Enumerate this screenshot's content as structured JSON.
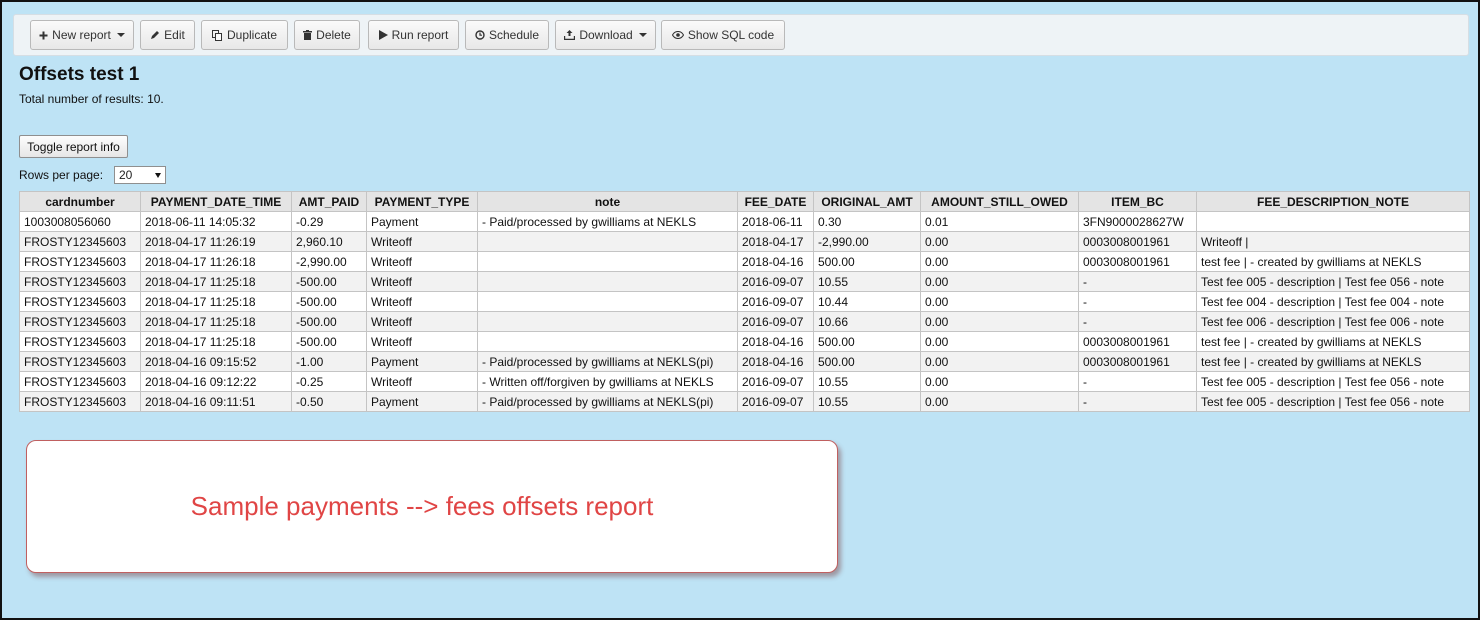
{
  "toolbar": {
    "new_report": "New report",
    "edit": "Edit",
    "duplicate": "Duplicate",
    "delete": "Delete",
    "run_report": "Run report",
    "schedule": "Schedule",
    "download": "Download",
    "show_sql": "Show SQL code"
  },
  "report": {
    "title": "Offsets test 1",
    "total_label": "Total number of results:",
    "total_value": "10.",
    "toggle_label": "Toggle report info",
    "rows_per_page_label": "Rows per page:",
    "rows_per_page_value": "20"
  },
  "table": {
    "columns": [
      "cardnumber",
      "PAYMENT_DATE_TIME",
      "AMT_PAID",
      "PAYMENT_TYPE",
      "note",
      "FEE_DATE",
      "ORIGINAL_AMT",
      "AMOUNT_STILL_OWED",
      "ITEM_BC",
      "FEE_DESCRIPTION_NOTE"
    ],
    "rows": [
      [
        "1003008056060",
        "2018-06-11 14:05:32",
        "-0.29",
        "Payment",
        "- Paid/processed by gwilliams at NEKLS",
        "2018-06-11",
        "0.30",
        "0.01",
        "3FN9000028627W",
        ""
      ],
      [
        "FROSTY12345603",
        "2018-04-17 11:26:19",
        "2,960.10",
        "Writeoff",
        "",
        "2018-04-17",
        "-2,990.00",
        "0.00",
        "0003008001961",
        "Writeoff |"
      ],
      [
        "FROSTY12345603",
        "2018-04-17 11:26:18",
        "-2,990.00",
        "Writeoff",
        "",
        "2018-04-16",
        "500.00",
        "0.00",
        "0003008001961",
        "test fee | - created by gwilliams at NEKLS"
      ],
      [
        "FROSTY12345603",
        "2018-04-17 11:25:18",
        "-500.00",
        "Writeoff",
        "",
        "2016-09-07",
        "10.55",
        "0.00",
        "-",
        "Test fee 005 - description | Test fee 056 - note"
      ],
      [
        "FROSTY12345603",
        "2018-04-17 11:25:18",
        "-500.00",
        "Writeoff",
        "",
        "2016-09-07",
        "10.44",
        "0.00",
        "-",
        "Test fee 004 - description | Test fee 004 - note"
      ],
      [
        "FROSTY12345603",
        "2018-04-17 11:25:18",
        "-500.00",
        "Writeoff",
        "",
        "2016-09-07",
        "10.66",
        "0.00",
        "-",
        "Test fee 006 - description | Test fee 006 - note"
      ],
      [
        "FROSTY12345603",
        "2018-04-17 11:25:18",
        "-500.00",
        "Writeoff",
        "",
        "2018-04-16",
        "500.00",
        "0.00",
        "0003008001961",
        "test fee | - created by gwilliams at NEKLS"
      ],
      [
        "FROSTY12345603",
        "2018-04-16 09:15:52",
        "-1.00",
        "Payment",
        "- Paid/processed by gwilliams at NEKLS(pi)",
        "2018-04-16",
        "500.00",
        "0.00",
        "0003008001961",
        "test fee | - created by gwilliams at NEKLS"
      ],
      [
        "FROSTY12345603",
        "2018-04-16 09:12:22",
        "-0.25",
        "Writeoff",
        "- Written off/forgiven by gwilliams at NEKLS",
        "2016-09-07",
        "10.55",
        "0.00",
        "-",
        "Test fee 005 - description | Test fee 056 - note"
      ],
      [
        "FROSTY12345603",
        "2018-04-16 09:11:51",
        "-0.50",
        "Payment",
        "- Paid/processed by gwilliams at NEKLS(pi)",
        "2016-09-07",
        "10.55",
        "0.00",
        "-",
        "Test fee 005 - description | Test fee 056 - note"
      ]
    ]
  },
  "annotation": {
    "text": "Sample payments --> fees offsets report",
    "text_color": "#e04545"
  },
  "colors": {
    "page_background": "#bee3f5",
    "toolbar_background": "#eef3f6",
    "table_header": "#e4e4e4"
  },
  "icons": {
    "new_report": "plus-icon",
    "edit": "pencil-icon",
    "duplicate": "copy-icon",
    "delete": "trash-icon",
    "run_report": "play-icon",
    "schedule": "clock-icon",
    "download": "upload-tray-icon",
    "show_sql": "eye-icon"
  }
}
